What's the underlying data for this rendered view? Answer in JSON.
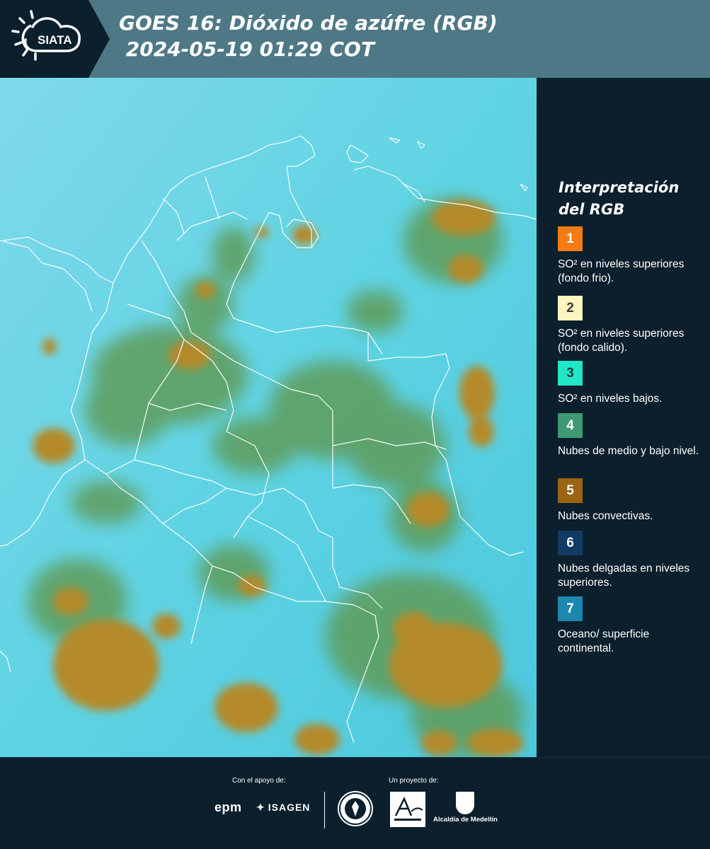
{
  "header": {
    "logo_text": "SIATA",
    "title_line1": "GOES 16: Dióxido de azúfre (RGB)",
    "title_line2": " 2024-05-19 01:29 COT"
  },
  "legend": {
    "title": "Interpretación del RGB",
    "items": [
      {
        "number": "1",
        "color": "#f47b16",
        "text_color": "#ffffff",
        "label": "SO² en niveles superiores (fondo frio)."
      },
      {
        "number": "2",
        "color": "#fdf4c0",
        "text_color": "#3a3a3a",
        "label": "SO² en niveles superiores (fondo calido)."
      },
      {
        "number": "3",
        "color": "#22e6c8",
        "text_color": "#1a3a3a",
        "label": "SO² en niveles bajos."
      },
      {
        "number": "4",
        "color": "#3e9a72",
        "text_color": "#ffffff",
        "label": "Nubes de medio y bajo nivel."
      },
      {
        "number": "5",
        "color": "#9a6410",
        "text_color": "#ffffff",
        "label": "Nubes convectivas."
      },
      {
        "number": "6",
        "color": "#123a66",
        "text_color": "#ffffff",
        "label": "Nubes delgadas en niveles superiores."
      },
      {
        "number": "7",
        "color": "#1d87b0",
        "text_color": "#ffffff",
        "label": "Oceano/ superficie continental."
      }
    ]
  },
  "footer": {
    "support_label": "Con el apoyo de:",
    "project_label": "Un proyecto de:",
    "sponsor_1": "epm",
    "sponsor_2": "ISAGEN",
    "partner_3": "Alcaldía de Medellín"
  },
  "colors": {
    "header_bg": "#4f7886",
    "panel_bg": "#0b1f2c",
    "sky_cyan": "#5fd6e6",
    "cloud_green": "#5a9a58",
    "convective_ochre": "#b88a2a",
    "border_white": "#ffffff"
  }
}
